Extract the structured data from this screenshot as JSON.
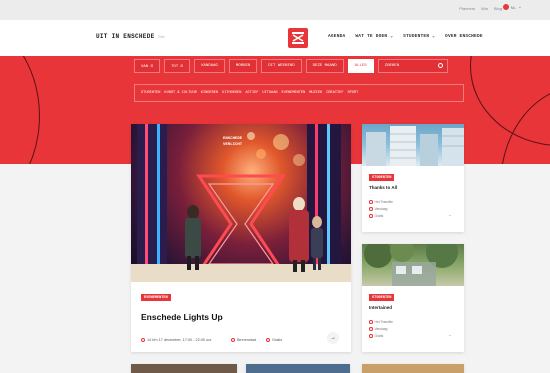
{
  "utility": {
    "links": [
      "Planners",
      "Win",
      "Blog"
    ],
    "lang": "NL"
  },
  "header": {
    "logo": "UIT IN ENSCHEDE",
    "logo_sub": "Site",
    "nav": [
      "AGENDA",
      "WAT TE DOEN ⌄",
      "STUDENTEN ⌄",
      "OVER ENSCHEDE"
    ]
  },
  "filters": {
    "row1": [
      "VAN  ⊡",
      "TOT  ⊡",
      "VANDAAG",
      "MORGEN",
      "DIT WEEKEND",
      "DEZE MAAND",
      "ALLES"
    ],
    "active_index": 6,
    "search_label": "ZOEKEN",
    "categories": [
      "STUDENTEN",
      "KUNST & CULTUUR",
      "KINDEREN",
      "UITHOEKEN",
      "ACTIEF",
      "UITGAAN",
      "EVENEMENTEN",
      "MUZIEK",
      "CREATIEF",
      "SPORT"
    ]
  },
  "featured": {
    "tag": "EVENEMENTEN",
    "title": "Enschede Lights Up",
    "image_text": [
      "ENSCHEDE",
      "VERLICHT"
    ],
    "date": "14 t/m 17 december, 17:00 - 22:00 uur",
    "location": "Binnenstad",
    "price": "Gratis",
    "arrow": "→"
  },
  "side_cards": [
    {
      "tag": "STUDENTEN",
      "title": "Thanks to All",
      "meta": [
        "Het Transitie",
        "Vandaag",
        "Gratis"
      ],
      "arrow": "→"
    },
    {
      "tag": "STUDENTEN",
      "title": "Intertained",
      "meta": [
        "Het Transitie",
        "Vandaag",
        "Gratis"
      ],
      "arrow": "→"
    }
  ],
  "colors": {
    "brand_red": "#e8353a",
    "background": "#f3f3f3"
  }
}
